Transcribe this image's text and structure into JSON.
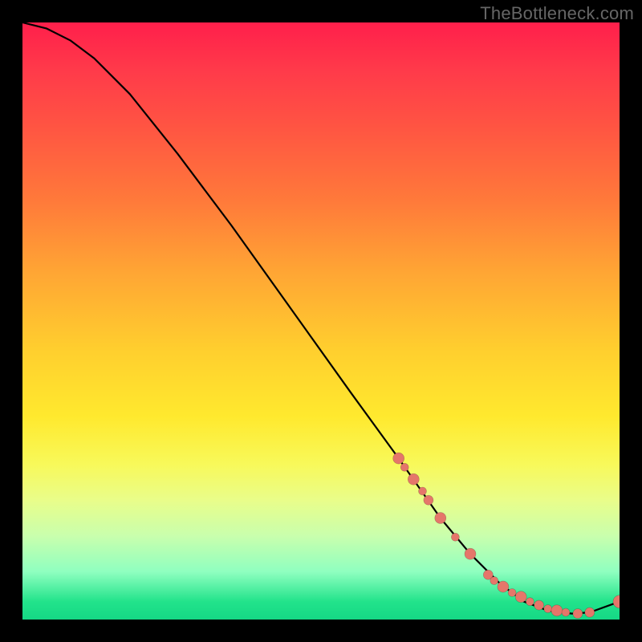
{
  "watermark": "TheBottleneck.com",
  "chart_data": {
    "type": "line",
    "title": "",
    "xlabel": "",
    "ylabel": "",
    "xlim": [
      0,
      100
    ],
    "ylim": [
      0,
      100
    ],
    "curve": {
      "x": [
        0,
        4,
        8,
        12,
        18,
        26,
        35,
        45,
        55,
        63,
        70,
        75,
        80,
        84,
        88,
        92,
        95,
        100
      ],
      "y": [
        100,
        99,
        97,
        94,
        88,
        78,
        66,
        52,
        38,
        27,
        17,
        11,
        6,
        3,
        1.5,
        1,
        1.2,
        3
      ]
    },
    "markers": {
      "x": [
        63,
        64,
        65.5,
        67,
        68,
        70,
        72.5,
        75,
        78,
        79,
        80.5,
        82,
        83.5,
        85,
        86.5,
        88,
        89.5,
        91,
        93,
        95,
        100
      ],
      "y": [
        27,
        25.5,
        23.5,
        21.5,
        20,
        17,
        13.8,
        11,
        7.5,
        6.5,
        5.5,
        4.5,
        3.8,
        3,
        2.4,
        1.8,
        1.5,
        1.2,
        1.0,
        1.2,
        3
      ],
      "r": [
        7,
        5,
        7,
        5,
        6,
        7,
        5,
        7,
        6,
        5,
        7,
        5,
        7,
        5,
        6,
        5,
        7,
        5,
        6,
        6,
        8
      ]
    },
    "colors": {
      "curve": "#000000",
      "marker": "#e5766a",
      "gradient_top": "#ff1f4b",
      "gradient_mid": "#ffe92e",
      "gradient_bot": "#15d885"
    }
  }
}
